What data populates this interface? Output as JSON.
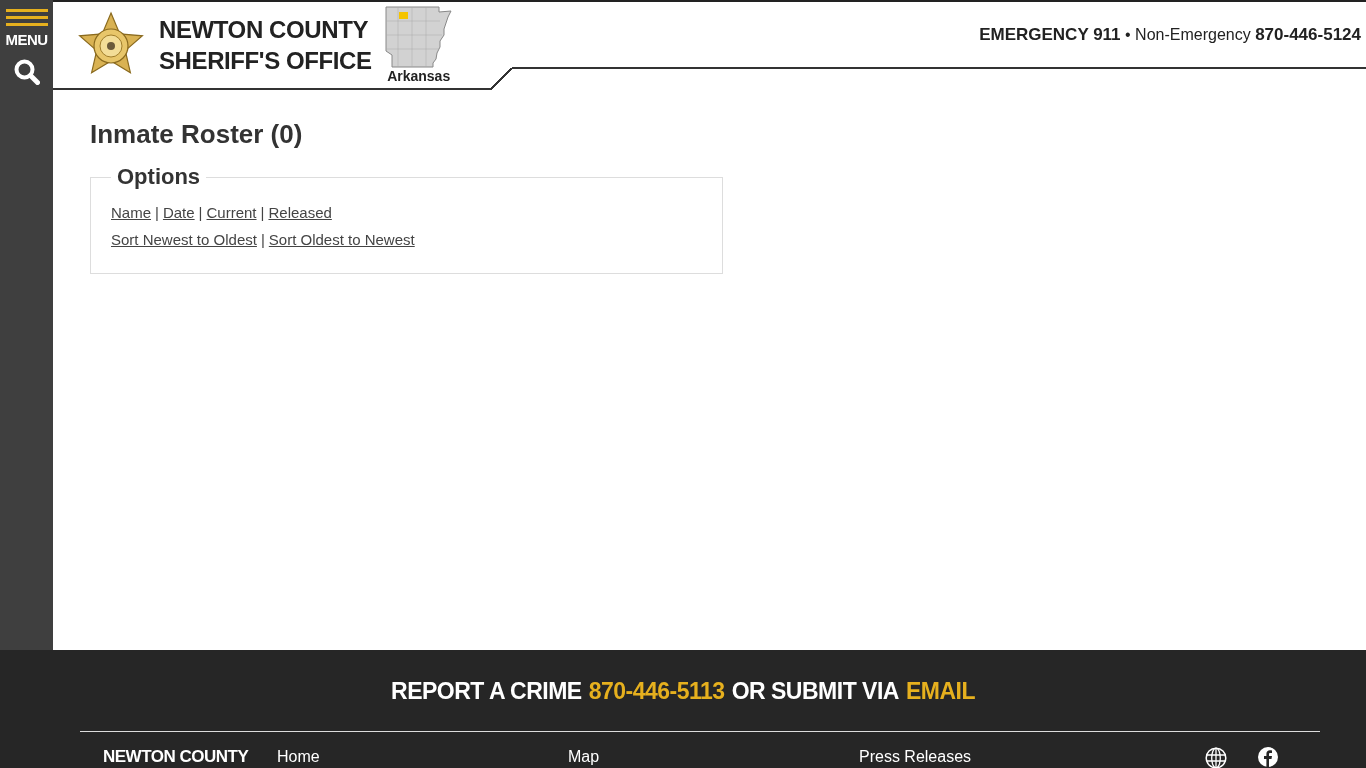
{
  "sidebar": {
    "menu_label": "MENU"
  },
  "header": {
    "title_lines": [
      "NEWTON COUNTY",
      "SHERIFF'S OFFICE"
    ],
    "state_label": "Arkansas",
    "contact": "**EMERGENCY 911** • Non-Emergency **870-446-5124**"
  },
  "page_title": "Inmate Roster (0)",
  "options": {
    "legend": "Options",
    "rows": [
      {
        "items": [
          {
            "kind": "link",
            "text": "Name"
          },
          {
            "kind": "separator",
            "text": "|"
          },
          {
            "kind": "link",
            "text": "Date"
          },
          {
            "kind": "separator",
            "text": "|"
          },
          {
            "kind": "link",
            "text": "Current"
          },
          {
            "kind": "separator",
            "text": "|"
          },
          {
            "kind": "link",
            "text": "Released"
          }
        ]
      },
      {
        "items": [
          {
            "kind": "link",
            "text": "Sort Newest to Oldest"
          },
          {
            "kind": "separator",
            "text": "|"
          },
          {
            "kind": "link",
            "text": "Sort Oldest to Newest"
          }
        ]
      }
    ]
  },
  "footer": {
    "cta": [
      {
        "kind": "text",
        "text": "REPORT A CRIME"
      },
      {
        "kind": "link",
        "text": "870-446-5113"
      },
      {
        "kind": "text",
        "text": "OR SUBMIT VIA"
      },
      {
        "kind": "link",
        "text": "EMAIL"
      }
    ],
    "brand": "NEWTON COUNTY",
    "nav": [
      "Home",
      "Map",
      "Press Releases"
    ]
  }
}
